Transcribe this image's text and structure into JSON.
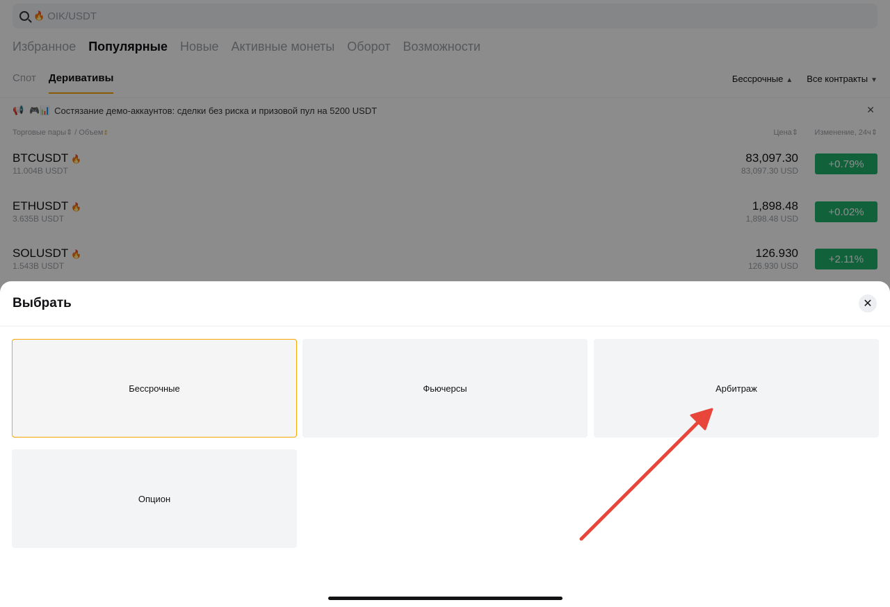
{
  "search": {
    "fire_icon": "fire-icon",
    "placeholder": "OIK/USDT"
  },
  "main_tabs": [
    {
      "label": "Избранное",
      "active": false
    },
    {
      "label": "Популярные",
      "active": true
    },
    {
      "label": "Новые",
      "active": false
    },
    {
      "label": "Активные монеты",
      "active": false
    },
    {
      "label": "Оборот",
      "active": false
    },
    {
      "label": "Возможности",
      "active": false
    }
  ],
  "sub_tabs": [
    {
      "label": "Спот",
      "active": false
    },
    {
      "label": "Деривативы",
      "active": true
    }
  ],
  "filters": {
    "contract_type": "Бессрочные",
    "contracts": "Все контракты"
  },
  "notice": {
    "text": "Состязание демо-аккаунтов: сделки без риска и призовой пул на 5200 USDT"
  },
  "columns": {
    "pair": "Торговые пары",
    "separator": "/",
    "volume": "Объем",
    "price": "Цена",
    "change": "Изменение, 24ч"
  },
  "rows": [
    {
      "symbol": "BTCUSDT",
      "volume": "11.004B USDT",
      "price": "83,097.30",
      "price_sub": "83,097.30 USD",
      "change": "+0.79%"
    },
    {
      "symbol": "ETHUSDT",
      "volume": "3.635B USDT",
      "price": "1,898.48",
      "price_sub": "1,898.48 USD",
      "change": "+0.02%"
    },
    {
      "symbol": "SOLUSDT",
      "volume": "1.543B USDT",
      "price": "126.930",
      "price_sub": "126.930 USD",
      "change": "+2.11%"
    }
  ],
  "sheet": {
    "title": "Выбрать",
    "options": [
      {
        "label": "Бессрочные",
        "selected": true
      },
      {
        "label": "Фьючерсы",
        "selected": false
      },
      {
        "label": "Арбитраж",
        "selected": false
      },
      {
        "label": "Опцион",
        "selected": false
      }
    ]
  },
  "colors": {
    "accent": "#f7a600",
    "positive": "#20b26c",
    "annotation_arrow": "#e8463a"
  }
}
